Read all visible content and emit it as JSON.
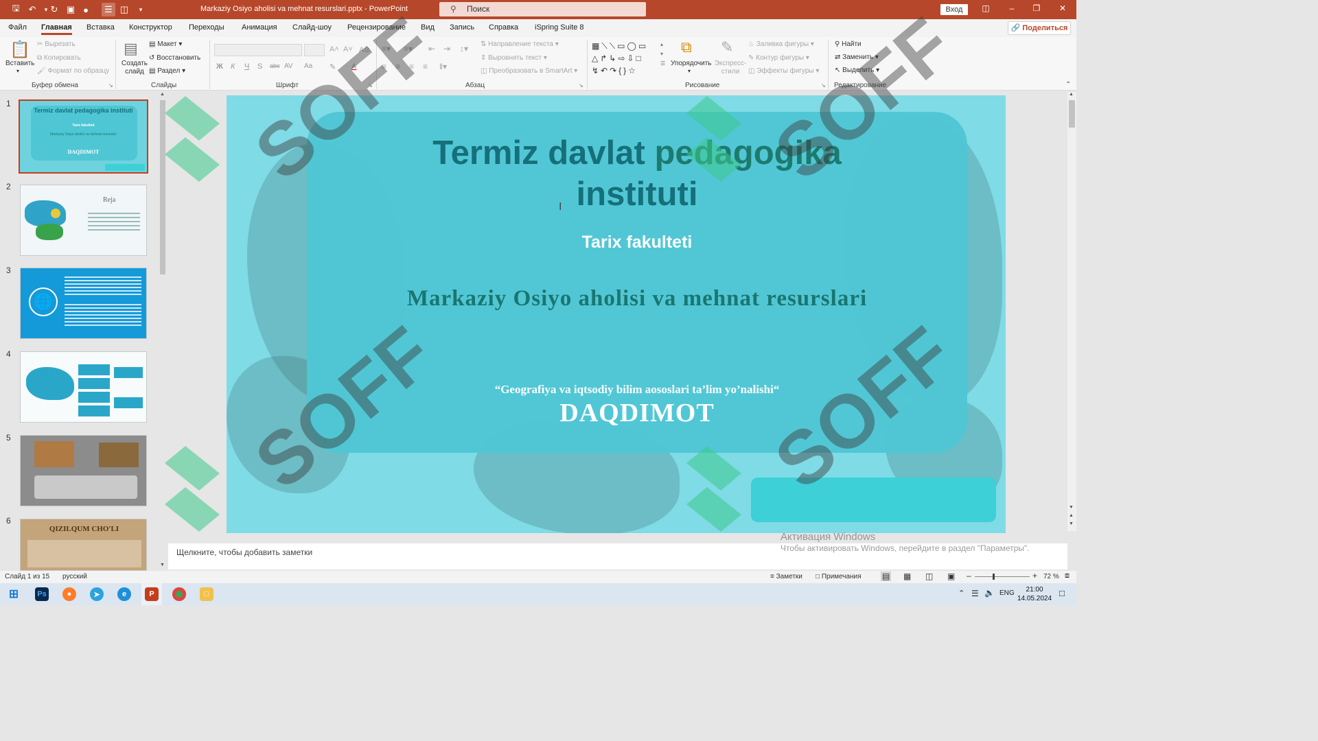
{
  "titlebar": {
    "doc_title": "Markaziy Osiyo aholisi va mehnat resurslari.pptx  -  PowerPoint",
    "search_placeholder": "Поиск",
    "login": "Вход"
  },
  "menu": {
    "tabs": [
      "Файл",
      "Главная",
      "Вставка",
      "Конструктор",
      "Переходы",
      "Анимация",
      "Слайд-шоу",
      "Рецензирование",
      "Вид",
      "Запись",
      "Справка",
      "iSpring Suite 8"
    ],
    "active": "Главная",
    "share": "Поделиться"
  },
  "ribbon": {
    "clipboard": {
      "paste": "Вставить",
      "cut": "Вырезать",
      "copy": "Копировать",
      "format_painter": "Формат по образцу",
      "label": "Буфер обмена"
    },
    "slides": {
      "new_slide": "Создать слайд",
      "layout": "Макет",
      "reset": "Восстановить",
      "section": "Раздел",
      "label": "Слайды"
    },
    "font": {
      "label": "Шрифт",
      "bold": "Ж",
      "italic": "К",
      "underline": "Ч",
      "shadow": "S",
      "strike": "abc",
      "spacing": "AV",
      "case": "Aa"
    },
    "paragraph": {
      "text_direction": "Направление текста",
      "align_text": "Выровнять текст",
      "convert_smartart": "Преобразовать в SmartArt",
      "label": "Абзац"
    },
    "drawing": {
      "arrange": "Упорядочить",
      "quick_styles": "Экспресс-стили",
      "shape_fill": "Заливка фигуры",
      "shape_outline": "Контур фигуры",
      "shape_effects": "Эффекты фигуры",
      "label": "Рисование"
    },
    "editing": {
      "find": "Найти",
      "replace": "Заменить",
      "select": "Выделить",
      "label": "Редактирование"
    }
  },
  "thumbnails": [
    {
      "num": "1",
      "title": "Termiz davlat pedagogika instituti",
      "sub": "Tarix fakulteti",
      "line": "Markaziy Osiyo aholisi va mehnat resurslari",
      "foot": "DAQDIMOT"
    },
    {
      "num": "2",
      "title": "Reja"
    },
    {
      "num": "3"
    },
    {
      "num": "4"
    },
    {
      "num": "5"
    },
    {
      "num": "6",
      "title": "QIZILQUM CHO'LI"
    }
  ],
  "slide": {
    "title_part1": "Termiz davlat ",
    "title_part2": "pedagogika",
    "title_part3": "instituti",
    "faculty": "Tarix fakulteti",
    "subject": "Markaziy Osiyo aholisi va mehnat resurslari",
    "direction": "“Geografiya va iqtsodiy bilim aososlari  ta’lim yo’nalishi“",
    "doc_type": "DAQDIMOT",
    "colors": {
      "background": "#7fdbe6",
      "card": "#4fc6d4",
      "title": "#166f7a"
    }
  },
  "notes": {
    "placeholder": "Щелкните, чтобы добавить заметки"
  },
  "activation": {
    "heading": "Активация Windows",
    "text": "Чтобы активировать Windows, перейдите в раздел \"Параметры\"."
  },
  "watermark": {
    "text": "SOFF"
  },
  "status": {
    "slide_counter": "Слайд 1 из 15",
    "language": "русский",
    "notes": "Заметки",
    "comments": "Примечания",
    "zoom": "72 %"
  },
  "taskbar": {
    "lang": "ENG",
    "time": "21:00",
    "date": "14.05.2024"
  }
}
